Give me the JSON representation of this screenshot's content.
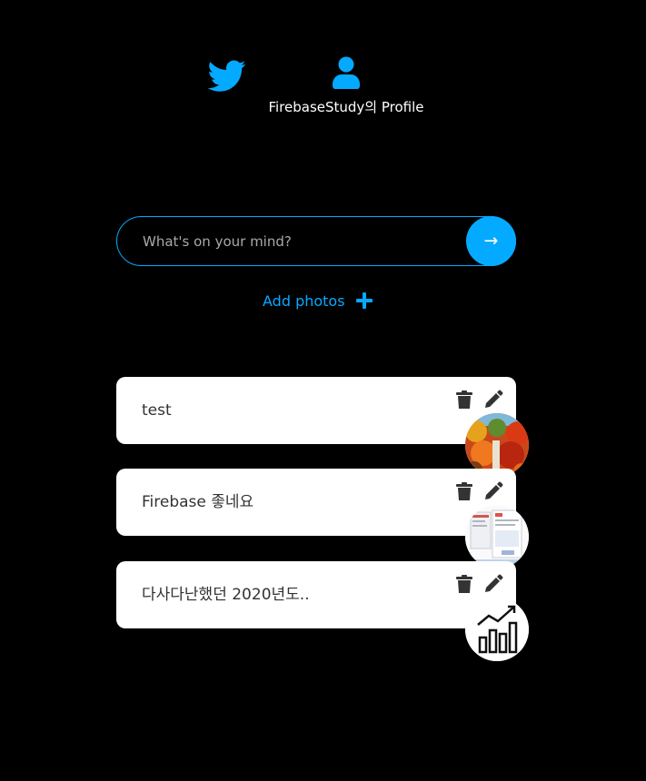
{
  "nav": {
    "home_icon": "twitter-bird-icon",
    "profile_icon": "user-icon",
    "profile_label": "FirebaseStudy의 Profile"
  },
  "composer": {
    "placeholder": "What's on your mind?",
    "value": "",
    "submit_label": "→"
  },
  "add_photos": {
    "label": "Add photos",
    "icon": "plus-icon"
  },
  "colors": {
    "background": "#000000",
    "accent": "#04aaff",
    "card": "#ffffff",
    "card_text": "#333333"
  },
  "tweets": [
    {
      "text": "test",
      "photo": "autumn-foliage-photo"
    },
    {
      "text": "Firebase 좋네요",
      "photo": "screenshot-thumbnail-photo"
    },
    {
      "text": "다사다난했던 2020년도..",
      "photo": "bar-chart-growth-photo"
    }
  ],
  "tweet_actions": {
    "delete_icon": "trash-icon",
    "edit_icon": "pencil-icon"
  }
}
